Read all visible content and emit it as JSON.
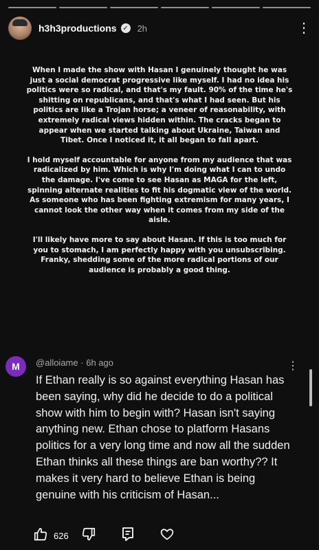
{
  "header": {
    "username": "h3h3productions",
    "time": "2h",
    "icons": {
      "verified": "verified-check-icon",
      "menu": "more-vert-icon"
    }
  },
  "story": {
    "paragraphs": [
      "When I made the show with Hasan I genuinely thought he was just a social democrat progressive like myself. I had no idea his politics were so radical, and that's my fault. 90% of the time he's shitting on republicans, and that's what I had seen. But his politics are like a Trojan horse; a veneer of reasonability, with extremely radical views hidden within. The cracks began to appear when we started talking about Ukraine, Taiwan and Tibet. Once I noticed it, it all began to fall apart.",
      "I hold myself accountable for anyone from my audience that was radicalized by him. Which is why I'm doing what I can to undo the damage. I've come to see Hasan as MAGA for the left, spinning alternate realities to fit his dogmatic view of the world.  As someone who has been fighting extremism for many years, I cannot look the other way when it comes from my side of the aisle.",
      "I'll likely have more to say about Hasan. If this is too much for you to stomach, I am perfectly happy with you unsubscribing. Franky, shedding some of the more radical portions of our audience is probably a good thing."
    ]
  },
  "comment": {
    "avatar_letter": "M",
    "handle": "@alloiame",
    "time": "6h ago",
    "text": "If Ethan really is so against everything Hasan has been saying, why did he decide to do a political show with him to begin with? Hasan isn't saying anything new. Ethan chose to platform Hasans politics for a very long time and now all the sudden Ethan thinks all these things are ban worthy?? It makes it very hard to believe Ethan is being genuine with his criticism of Hasan...",
    "avatar_color": "#7b2cbf"
  },
  "actions": {
    "like_count": "626",
    "icons": [
      "thumbs-up-icon",
      "thumbs-down-icon",
      "reply-icon",
      "heart-icon"
    ]
  }
}
